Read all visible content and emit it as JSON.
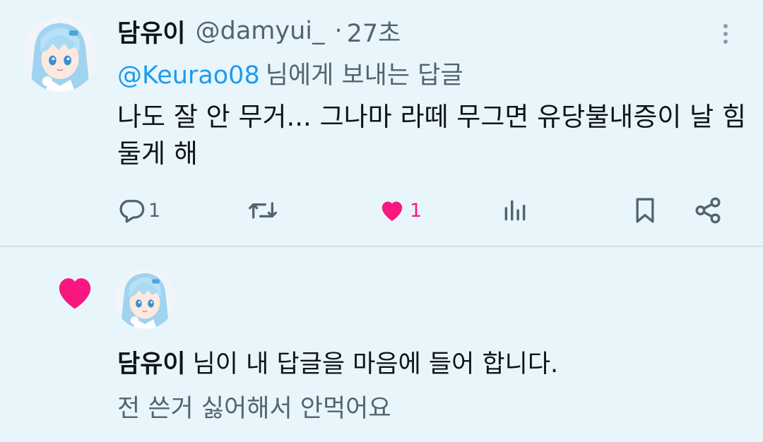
{
  "tweet": {
    "display_name": "담유이",
    "handle": "@damyui_",
    "separator": "·",
    "time": "27초",
    "more_icon": "vertical-dots-icon",
    "replying_mention": "@Keurao08",
    "replying_suffix": "님에게 보내는 답글",
    "text": "나도 잘 안 무거... 그나마 라떼 무그면 유당불내증이 날 힘둘게 해",
    "actions": {
      "reply": {
        "icon": "reply-icon",
        "count": "1"
      },
      "retweet": {
        "icon": "retweet-icon"
      },
      "like": {
        "icon": "heart-filled-icon",
        "count": "1",
        "liked": true
      },
      "views": {
        "icon": "views-icon"
      },
      "bookmark": {
        "icon": "bookmark-icon"
      },
      "share": {
        "icon": "share-icon"
      }
    }
  },
  "notification": {
    "icon": "heart-filled-icon",
    "actor": "담유이",
    "message": "님이 내 답글을 마음에 들어 합니다.",
    "quoted_text": "전 쓴거 싫어해서 안먹어요"
  },
  "colors": {
    "background": "#e8f6fc",
    "accent_blue": "#1d9bf0",
    "like_pink": "#f91880",
    "secondary_text": "#536471",
    "primary_text": "#0f1419"
  }
}
